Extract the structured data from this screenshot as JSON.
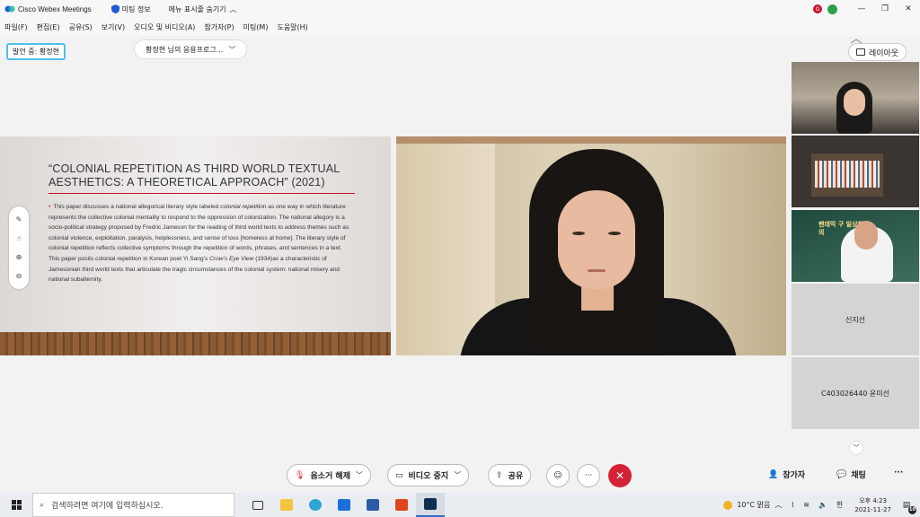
{
  "titlebar": {
    "app_title": "Cisco Webex Meetings",
    "meeting_info": "미팅 정보",
    "hide_menu": "메뉴 표시줄 숨기기",
    "status_badge": "O"
  },
  "menubar": {
    "items": [
      "파일(F)",
      "편집(E)",
      "공유(S)",
      "보기(V)",
      "오디오 및 비디오(A)",
      "참가자(P)",
      "미팅(M)",
      "도움말(H)"
    ]
  },
  "toolbar": {
    "speaking_label": "발언 중: 황정현",
    "share_dropdown": "황정현 님의 응용프로그...",
    "layout_label": "레이아웃"
  },
  "slide": {
    "title": "“COLONIAL REPETITION AS THIRD WORLD TEXTUAL AESTHETICS: A THEORETICAL APPROACH” (2021)",
    "body_1": "This paper discusses a national allegorical literary style labeled ",
    "body_italic_1": "colonial repetition",
    "body_2": " as one way in which literature represents the collective colonial mentality to respond to the oppression of colonization. The national allegory is a socio-political strategy proposed by Fredric Jameson for the reading of third world texts to address themes such as colonial violence, exploitation, paralysis, helplessness, and sense of loss [homeless at home]. The literary style of colonial repetition reflects collective symptoms through the repetition of words, phrases, and sentences in a text. This paper posits colonial repetition in Korean poet Yi Sang’s ",
    "body_italic_2": "Crow’s Eye View",
    "body_3": " (1934)as a characteristic of Jamesonian third world texts that articulate the tragic circumstances of the colonial system: national misery and national subalternity."
  },
  "participants": {
    "empty_1": "신지선",
    "empty_2": "C403026440 윤미선",
    "thumb3_text": "팬데믹 구 일상회복의"
  },
  "controls": {
    "mute": "음소거 해제",
    "video": "비디오 중지",
    "share": "공유",
    "participants": "참가자",
    "chat": "채팅",
    "more": "···"
  },
  "taskbar": {
    "search_placeholder": "검색하려면 여기에 입력하십시오.",
    "weather": "10°C 맑음",
    "ime": "한",
    "time": "오후 4:23",
    "date": "2021-11-27",
    "notifications": "10"
  }
}
